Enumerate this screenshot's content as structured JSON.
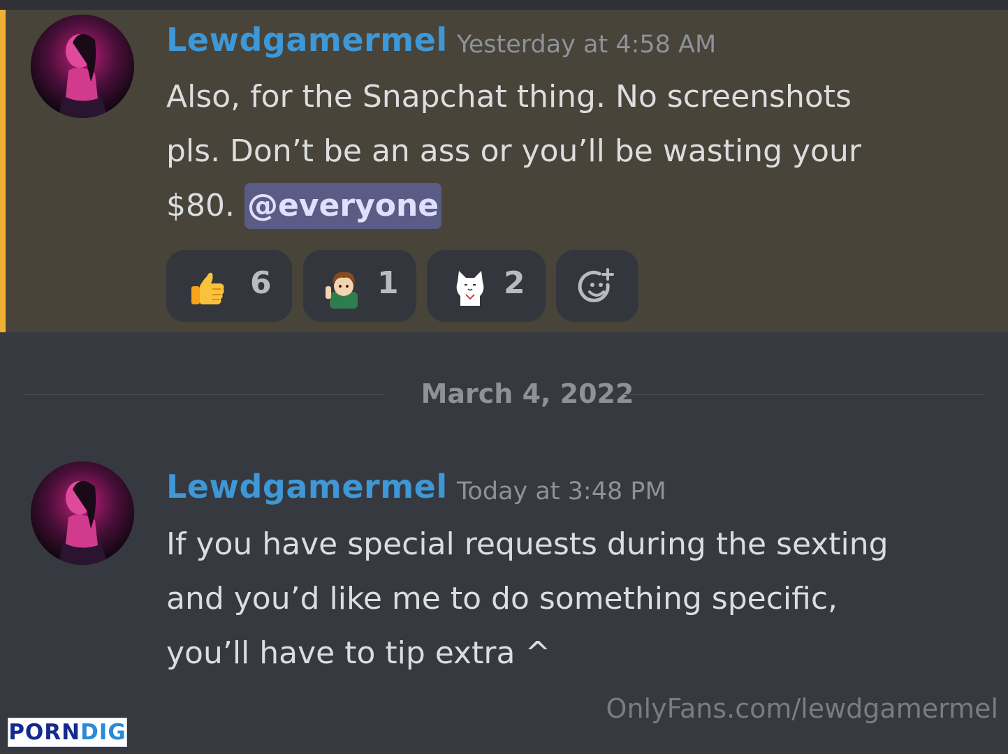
{
  "colors": {
    "background": "#36393f",
    "highlight_background": "#48443a",
    "highlight_accent": "#f0b132",
    "username": "#3e97d6",
    "mention_background": "#5a5c85",
    "mention_text": "#dee0fc"
  },
  "messages": [
    {
      "author": "Lewdgamermel",
      "timestamp": "Yesterday at 4:58 AM",
      "avatar_icon": "user-avatar",
      "highlighted": true,
      "lines": [
        "Also, for the Snapchat thing. No screenshots",
        "pls. Don’t be an ass or you’ll be wasting your",
        "$80."
      ],
      "mention": "@everyone",
      "reactions": [
        {
          "emoji": "thumbs-up-emoji",
          "count": "6"
        },
        {
          "emoji": "anime-boy-emoji",
          "count": "1"
        },
        {
          "emoji": "white-cat-emoji",
          "count": "2"
        }
      ],
      "add_reaction_icon": "add-reaction-icon"
    },
    {
      "author": "Lewdgamermel",
      "timestamp": "Today at 3:48 PM",
      "avatar_icon": "user-avatar",
      "highlighted": false,
      "lines": [
        "If you have special requests during the sexting",
        "and you’d like me to do something specific,",
        "you’ll have to tip extra ^"
      ]
    }
  ],
  "date_divider": "March 4, 2022",
  "watermark": "OnlyFans.com/lewdgamermel",
  "site_badge": {
    "part1": "PORN",
    "part2": "DIG"
  }
}
